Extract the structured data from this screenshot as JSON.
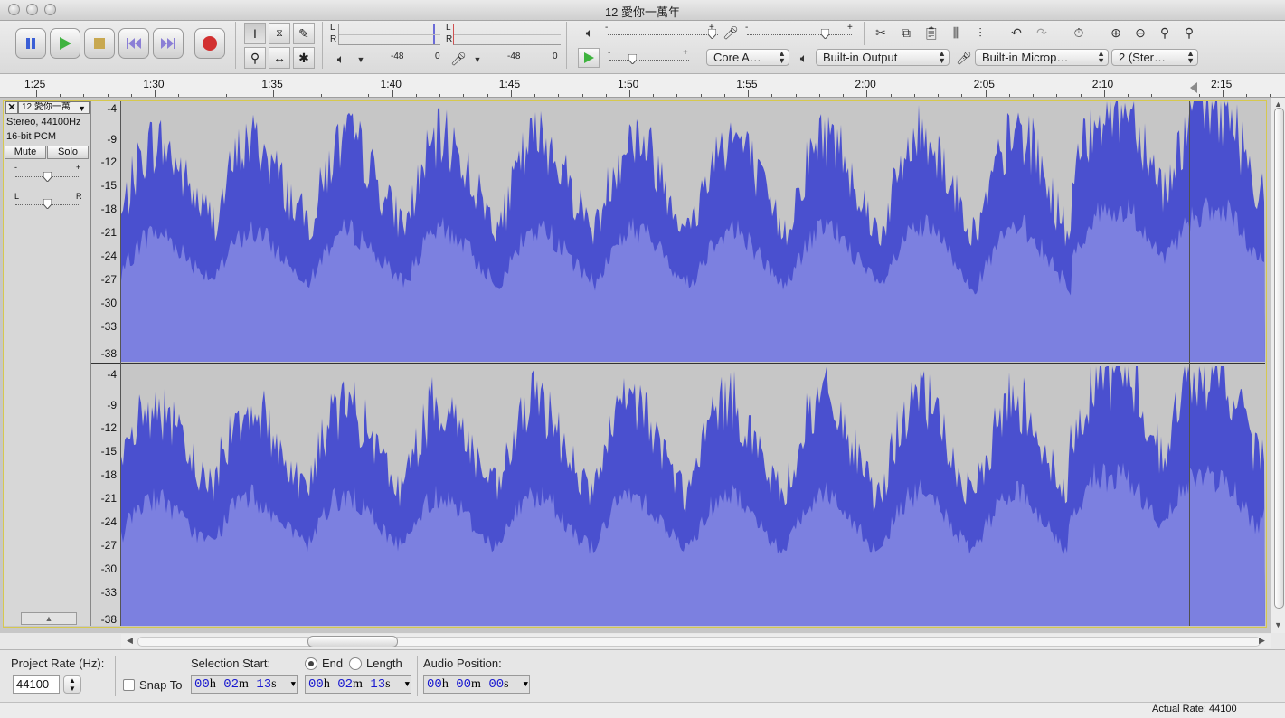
{
  "window": {
    "title": "12 愛你一萬年"
  },
  "meters": {
    "playback": {
      "channel_l": "L",
      "channel_r": "R",
      "scale_min": "-48",
      "scale_zero": "0"
    },
    "record": {
      "channel_l": "L",
      "channel_r": "R",
      "scale_min": "-48",
      "scale_zero": "0"
    }
  },
  "mixer": {
    "minus": "-",
    "plus": "+"
  },
  "devices": {
    "host": "Core A…",
    "output": "Built-in Output",
    "input": "Built-in Microp…",
    "channels": "2 (Ster…"
  },
  "ruler": {
    "labels": [
      "1:25",
      "1:30",
      "1:35",
      "1:40",
      "1:45",
      "1:50",
      "1:55",
      "2:00",
      "2:05",
      "2:10",
      "2:15"
    ]
  },
  "track": {
    "name": "12 愛你一萬",
    "info_line1": "Stereo, 44100Hz",
    "info_line2": "16-bit PCM",
    "mute_label": "Mute",
    "solo_label": "Solo",
    "gain_minus": "-",
    "gain_plus": "+",
    "pan_left": "L",
    "pan_right": "R",
    "db_scale": [
      "-4",
      "-9",
      "-12",
      "-15",
      "-18",
      "-21",
      "-24",
      "-27",
      "-30",
      "-33",
      "-38"
    ]
  },
  "selection": {
    "project_rate_label": "Project Rate (Hz):",
    "project_rate_value": "44100",
    "snap_to_label": "Snap To",
    "selection_start_label": "Selection Start:",
    "end_label": "End",
    "length_label": "Length",
    "audio_position_label": "Audio Position:",
    "start": {
      "h": "00",
      "m": "02",
      "s": "13"
    },
    "end": {
      "h": "00",
      "m": "02",
      "s": "13"
    },
    "position": {
      "h": "00",
      "m": "00",
      "s": "00"
    },
    "unit_h": "h",
    "unit_m": "m",
    "unit_s": "s"
  },
  "status": {
    "actual_rate": "Actual Rate: 44100"
  },
  "colors": {
    "wave_fill": "#4a50cf",
    "wave_rms": "#7c80e0",
    "track_bg": "#c6c6c6",
    "playhead": "#505050"
  }
}
